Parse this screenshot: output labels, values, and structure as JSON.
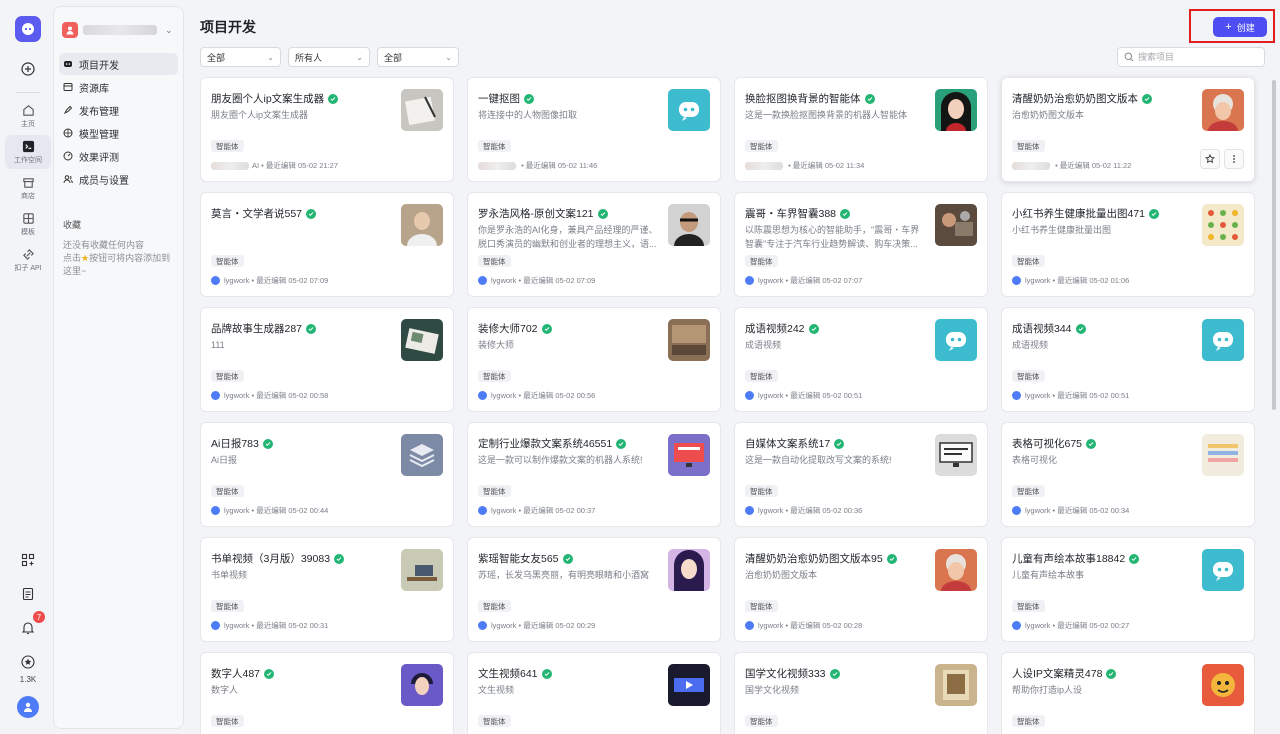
{
  "rail": {
    "items": [
      {
        "label": "主页",
        "icon": "home-icon"
      },
      {
        "label": "工作空间",
        "icon": "terminal-icon"
      },
      {
        "label": "商店",
        "icon": "store-icon"
      },
      {
        "label": "模板",
        "icon": "template-icon"
      },
      {
        "label": "扣子 API",
        "icon": "api-icon"
      }
    ],
    "notification_count": "7",
    "stars_count": "1.3K"
  },
  "sidebar": {
    "nav": [
      {
        "label": "项目开发"
      },
      {
        "label": "资源库"
      },
      {
        "label": "发布管理"
      },
      {
        "label": "模型管理"
      },
      {
        "label": "效果评测"
      },
      {
        "label": "成员与设置"
      }
    ],
    "favorites_title": "收藏",
    "favorites_tip_1": "还没有收藏任何内容",
    "favorites_tip_2": "点击",
    "favorites_tip_3": "按钮可将内容添加到这里~"
  },
  "header": {
    "title": "项目开发",
    "create_label": "创建"
  },
  "filters": [
    {
      "value": "全部"
    },
    {
      "value": "所有人"
    },
    {
      "value": "全部"
    }
  ],
  "search": {
    "placeholder": "搜索项目"
  },
  "colors": {
    "accent": "#4e4ef2",
    "check": "#22b573",
    "highlight_border": "#e11d1d"
  },
  "cards": [
    {
      "title": "朋友圈个人ip文案生成器",
      "desc": "朋友圈个人ip文案生成器",
      "tag": "智能体",
      "owner": "AI",
      "edited": "最近编辑 05-02 21:27",
      "thumb": "notebook"
    },
    {
      "title": "一键抠图",
      "desc": "将连接中的人物图像扣取",
      "tag": "智能体",
      "owner": "",
      "edited": "最近编辑 05-02 11:46",
      "thumb": "bot"
    },
    {
      "title": "换脸抠图换背景的智能体",
      "desc": "这是一款换脸抠图换背景的机器人智能体",
      "tag": "智能体",
      "owner": "",
      "edited": "最近编辑 05-02 11:34",
      "thumb": "woman"
    },
    {
      "title": "清醒奶奶治愈奶奶图文版本",
      "desc": "治愈奶奶图文版本",
      "tag": "智能体",
      "owner": "",
      "edited": "最近编辑 05-02 11:22",
      "thumb": "granny"
    },
    {
      "title": "莫言・文学者说557",
      "desc": "",
      "tag": "智能体",
      "owner": "lygwork",
      "edited": "最近编辑 05-02 07:09",
      "thumb": "oldman"
    },
    {
      "title": "罗永浩风格-原创文案121",
      "desc": "你是罗永浩的AI化身，兼具产品经理的严谨、脱口秀演员的幽默和创业者的理想主义，语...",
      "tag": "智能体",
      "owner": "lygwork",
      "edited": "最近编辑 05-02 07:09",
      "thumb": "glasses"
    },
    {
      "title": "震哥・车界智囊388",
      "desc": "以陈震思想为核心的智能助手，\"震哥・车界智囊\"专注于汽车行业趋势解读、购车决策...",
      "tag": "智能体",
      "owner": "lygwork",
      "edited": "最近编辑 05-02 07:07",
      "thumb": "mechanic"
    },
    {
      "title": "小红书养生健康批量出图471",
      "desc": "小红书养生健康批量出图",
      "tag": "智能体",
      "owner": "lygwork",
      "edited": "最近编辑 05-02 01:06",
      "thumb": "food"
    },
    {
      "title": "品牌故事生成器287",
      "desc": "111",
      "tag": "智能体",
      "owner": "lygwork",
      "edited": "最近编辑 05-02 00:58",
      "thumb": "book"
    },
    {
      "title": "装修大师702",
      "desc": "装修大师",
      "tag": "智能体",
      "owner": "lygwork",
      "edited": "最近编辑 05-02 00:56",
      "thumb": "room"
    },
    {
      "title": "成语视频242",
      "desc": "成语视频",
      "tag": "智能体",
      "owner": "lygwork",
      "edited": "最近编辑 05-02 00:51",
      "thumb": "bot"
    },
    {
      "title": "成语视频344",
      "desc": "成语视频",
      "tag": "智能体",
      "owner": "lygwork",
      "edited": "最近编辑 05-02 00:51",
      "thumb": "bot"
    },
    {
      "title": "Ai日报783",
      "desc": "Ai日报",
      "tag": "智能体",
      "owner": "lygwork",
      "edited": "最近编辑 05-02 00:44",
      "thumb": "layers"
    },
    {
      "title": "定制行业爆款文案系统46551",
      "desc": "这是一款可以制作爆款文案的机器人系统!",
      "tag": "智能体",
      "owner": "lygwork",
      "edited": "最近编辑 05-02 00:37",
      "thumb": "monitor-red"
    },
    {
      "title": "自媒体文案系统17",
      "desc": "这是一款自动化提取改写文案的系统!",
      "tag": "智能体",
      "owner": "lygwork",
      "edited": "最近编辑 05-02 00:36",
      "thumb": "monitor-white"
    },
    {
      "title": "表格可视化675",
      "desc": "表格可视化",
      "tag": "智能体",
      "owner": "lygwork",
      "edited": "最近编辑 05-02 00:34",
      "thumb": "sheet"
    },
    {
      "title": "书单视频（3月版）39083",
      "desc": "书单视频",
      "tag": "智能体",
      "owner": "lygwork",
      "edited": "最近编辑 05-02 00:31",
      "thumb": "desk"
    },
    {
      "title": "紫瑶智能女友565",
      "desc": "苏瑶，长发乌黑亮丽，有明亮眼睛和小酒窝",
      "tag": "智能体",
      "owner": "lygwork",
      "edited": "最近编辑 05-02 00:29",
      "thumb": "anime"
    },
    {
      "title": "清醒奶奶治愈奶奶图文版本95",
      "desc": "治愈奶奶图文版本",
      "tag": "智能体",
      "owner": "lygwork",
      "edited": "最近编辑 05-02 00:28",
      "thumb": "granny"
    },
    {
      "title": "儿童有声绘本故事18842",
      "desc": "儿童有声绘本故事",
      "tag": "智能体",
      "owner": "lygwork",
      "edited": "最近编辑 05-02 00:27",
      "thumb": "bot"
    },
    {
      "title": "数字人487",
      "desc": "数字人",
      "tag": "智能体",
      "owner": "",
      "edited": "",
      "thumb": "boy"
    },
    {
      "title": "文生视频641",
      "desc": "文生视频",
      "tag": "智能体",
      "owner": "",
      "edited": "",
      "thumb": "video"
    },
    {
      "title": "国学文化视频333",
      "desc": "国学文化视频",
      "tag": "智能体",
      "owner": "",
      "edited": "",
      "thumb": "scroll"
    },
    {
      "title": "人设IP文案精灵478",
      "desc": "帮助你打造ip人设",
      "tag": "智能体",
      "owner": "",
      "edited": "",
      "thumb": "dragon"
    }
  ]
}
